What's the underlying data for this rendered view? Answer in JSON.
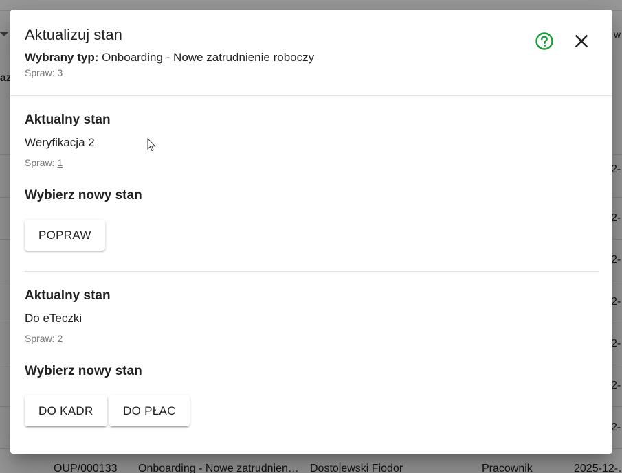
{
  "background": {
    "bottom_row": {
      "id": "OUP/000133",
      "type": "Onboarding - Nowe zatrudnien…",
      "person": "Dostojewski Fiodor",
      "role": "Pracownik",
      "date": "2025-12-…"
    },
    "fragments": {
      "left_header": "azw",
      "right_header": "w",
      "date_frag": "2-…"
    }
  },
  "dialog": {
    "title": "Aktualizuj stan",
    "type_label": "Wybrany typ:",
    "type_value": "Onboarding - Nowe zatrudnienie roboczy",
    "count_text": "Spraw: 3",
    "help_icon": "help-circle-icon",
    "close_icon": "close-icon",
    "accent_color": "#1a9e3a",
    "sections": [
      {
        "current_heading": "Aktualny stan",
        "current_state": "Weryfikacja 2",
        "count_label": "Spraw:",
        "count_value": "1",
        "choose_heading": "Wybierz nowy stan",
        "buttons": [
          "POPRAW"
        ]
      },
      {
        "current_heading": "Aktualny stan",
        "current_state": "Do eTeczki",
        "count_label": "Spraw:",
        "count_value": "2",
        "choose_heading": "Wybierz nowy stan",
        "buttons": [
          "DO KADR",
          "DO PŁAC"
        ]
      }
    ]
  }
}
